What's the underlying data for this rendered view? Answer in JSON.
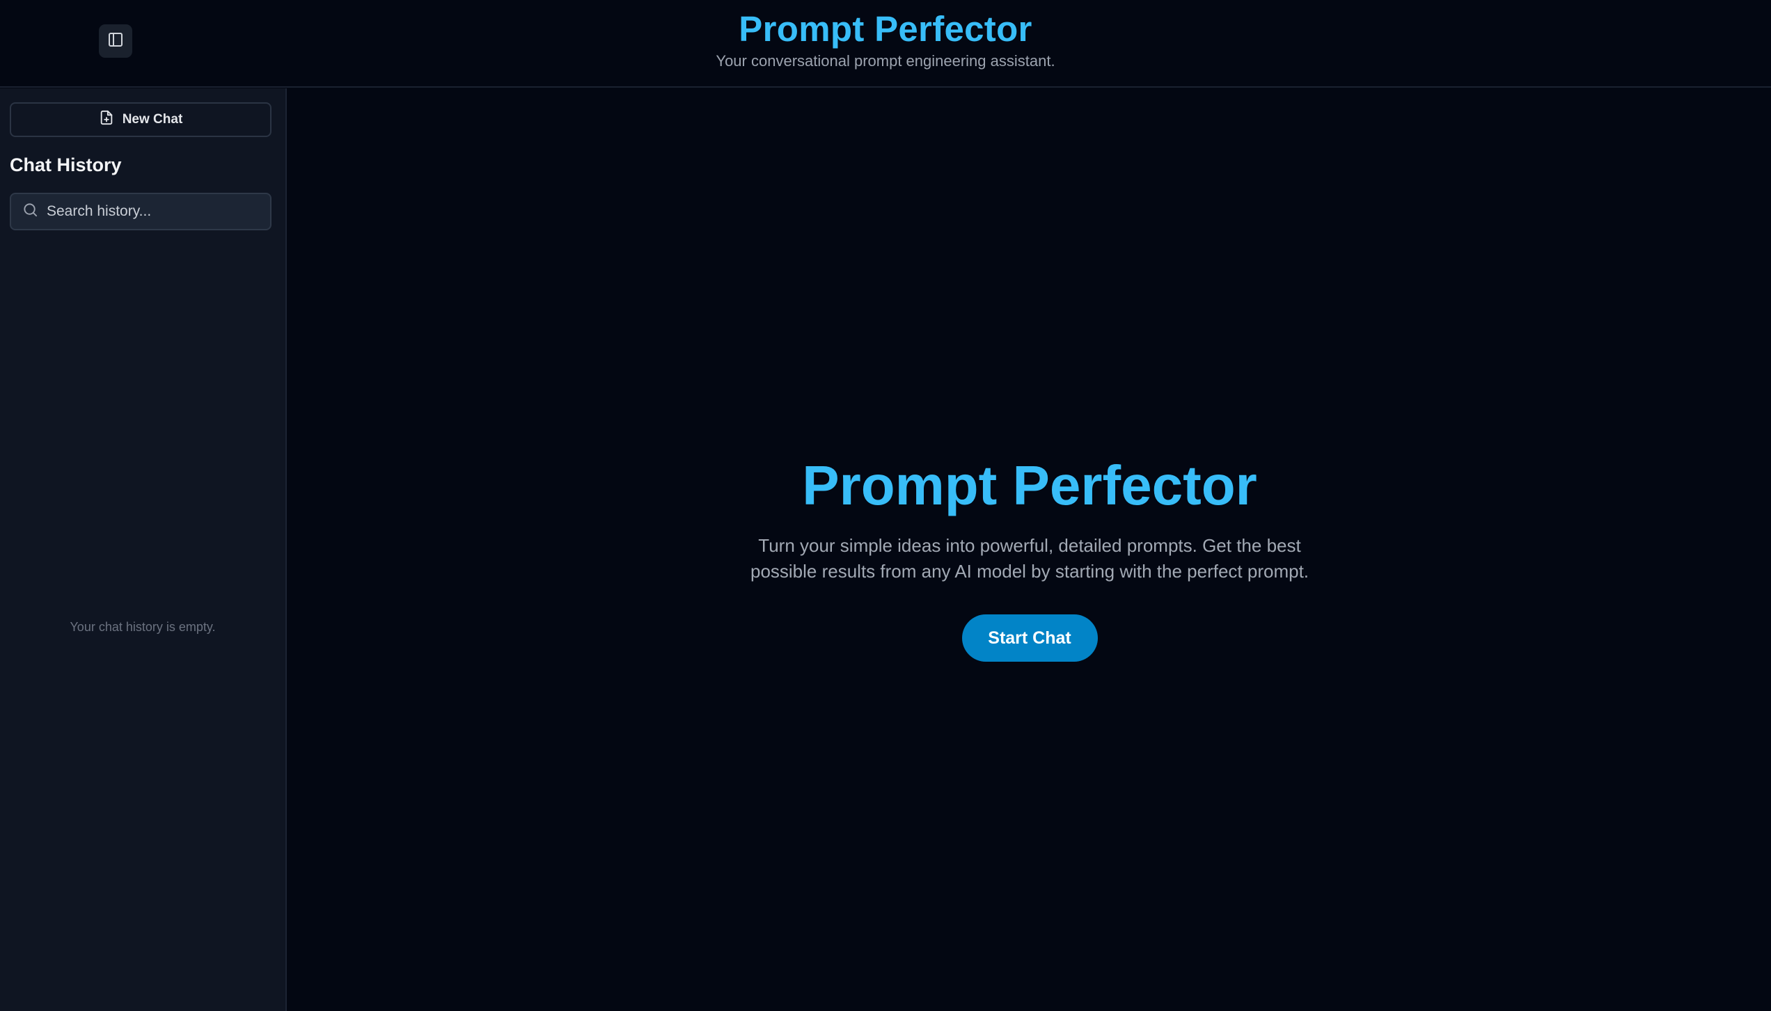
{
  "header": {
    "title": "Prompt Perfector",
    "subtitle": "Your conversational prompt engineering assistant.",
    "toggle_icon": "sidebar-panel-icon"
  },
  "sidebar": {
    "new_chat_label": "New Chat",
    "new_chat_icon": "file-plus-icon",
    "history_heading": "Chat History",
    "search": {
      "placeholder": "Search history...",
      "value": "",
      "icon": "search-icon"
    },
    "empty_message": "Your chat history is empty."
  },
  "main": {
    "hero_title": "Prompt Perfector",
    "hero_text": "Turn your simple ideas into powerful, detailed prompts. Get the best possible results from any AI model by starting with the perfect prompt.",
    "start_button": "Start Chat"
  },
  "colors": {
    "accent": "#38bdf8",
    "button": "#0284c7",
    "background": "#030712",
    "sidebar": "#0f1522"
  }
}
